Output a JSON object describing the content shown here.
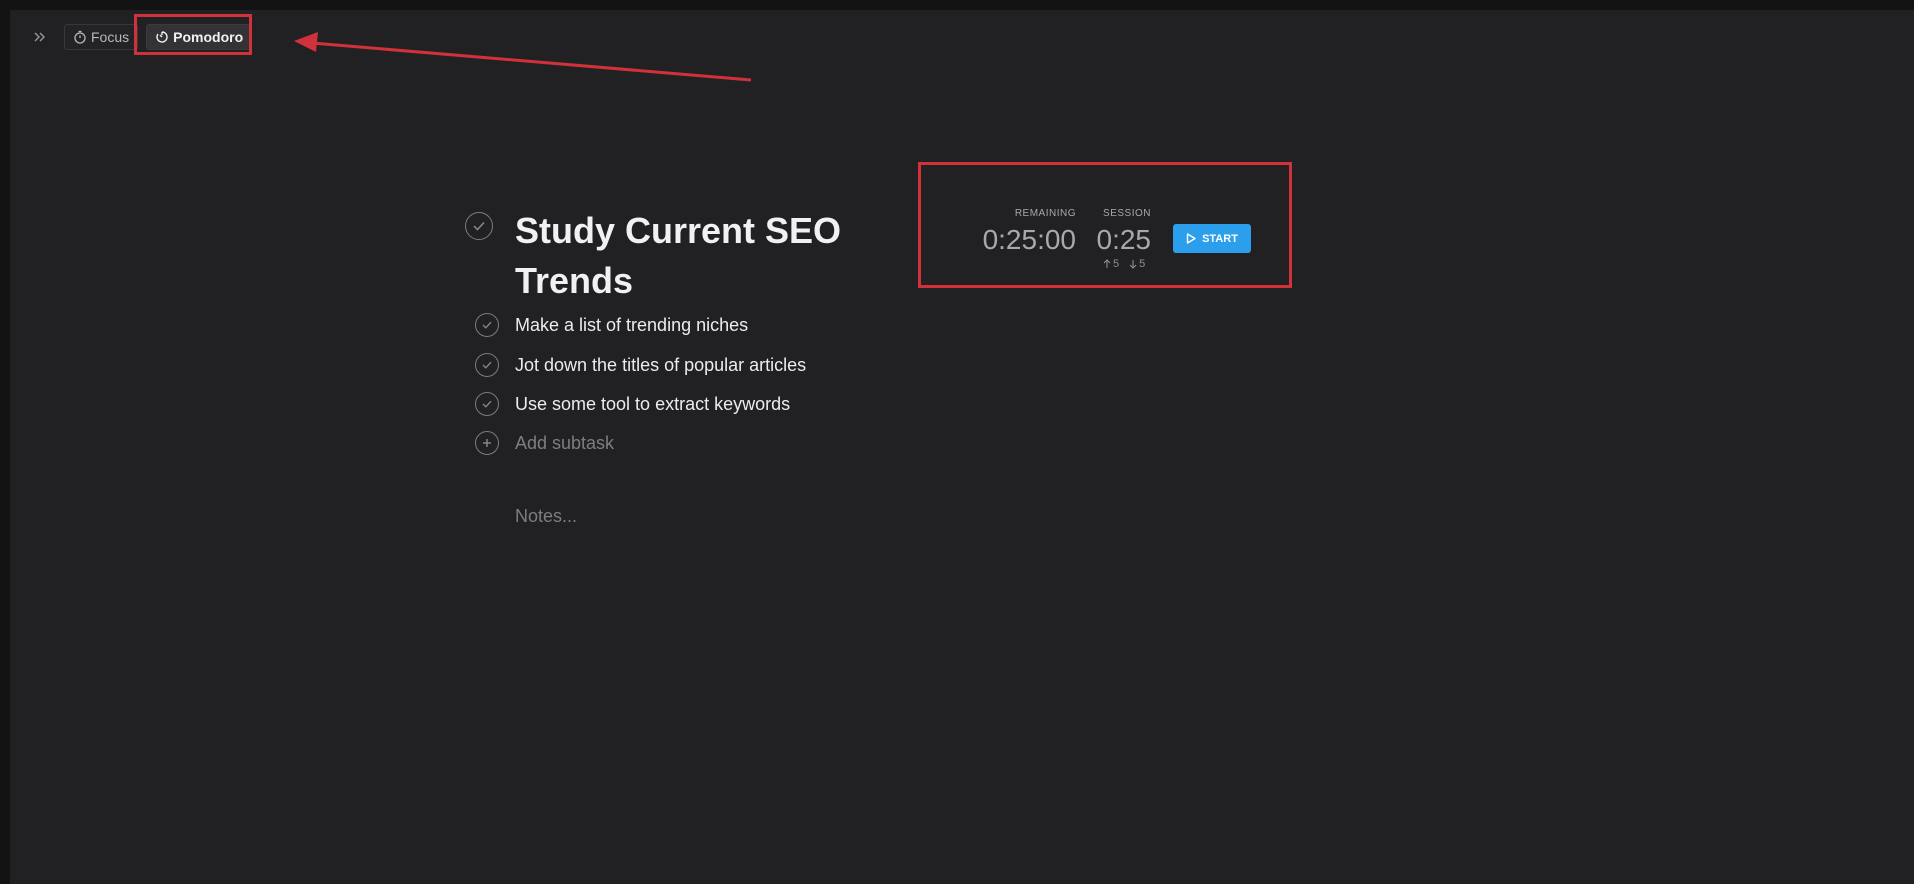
{
  "toolbar": {
    "expand_icon": "chevrons-right-icon",
    "focus_label": "Focus",
    "pomodoro_label": "Pomodoro"
  },
  "task": {
    "title": "Study Current SEO Trends",
    "subtasks": [
      {
        "label": "Make a list of trending niches"
      },
      {
        "label": "Jot down the titles of popular articles"
      },
      {
        "label": "Use some tool to extract keywords"
      }
    ],
    "add_subtask_label": "Add subtask",
    "notes_placeholder": "Notes..."
  },
  "pomodoro": {
    "remaining_label": "REMAINING",
    "remaining_value": "0:25:00",
    "session_label": "SESSION",
    "session_value": "0:25",
    "increase_value": "5",
    "decrease_value": "5",
    "start_label": "START"
  },
  "colors": {
    "background": "#212123",
    "accent": "#2b9fec",
    "annotation": "#d1313a"
  }
}
